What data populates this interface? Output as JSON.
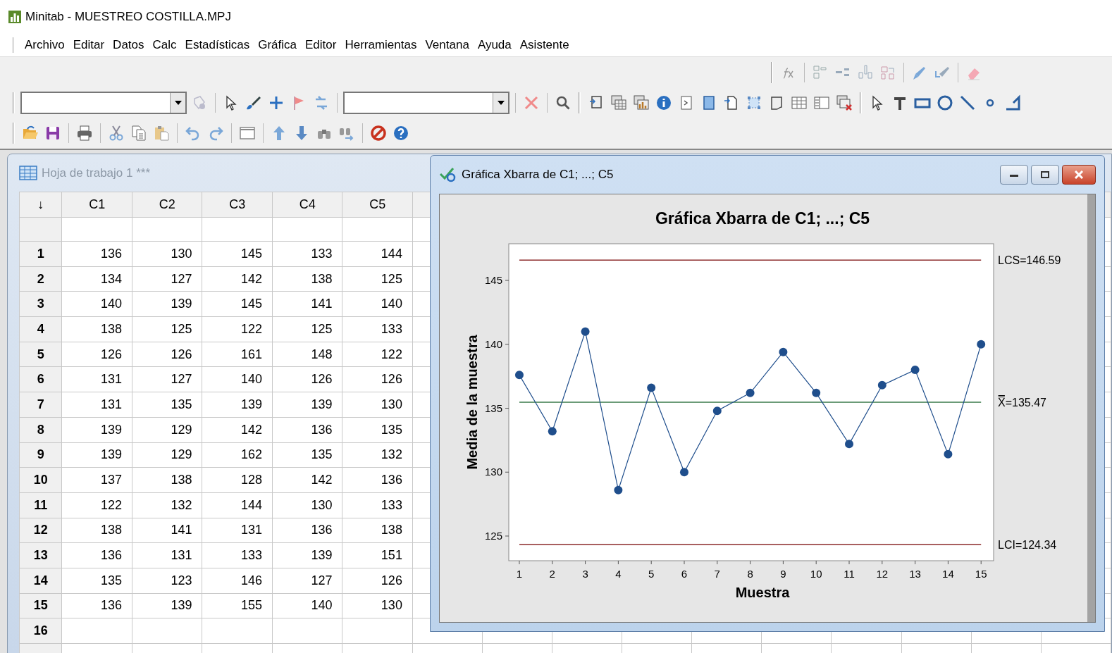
{
  "window": {
    "title": "Minitab - MUESTREO COSTILLA.MPJ"
  },
  "menu": [
    "Archivo",
    "Editar",
    "Datos",
    "Calc",
    "Estadísticas",
    "Gráfica",
    "Editor",
    "Herramientas",
    "Ventana",
    "Ayuda",
    "Asistente"
  ],
  "worksheet": {
    "title": "Hoja de trabajo 1 ***",
    "corner": "↓",
    "columns": [
      "C1",
      "C2",
      "C3",
      "C4",
      "C5"
    ],
    "rows": [
      {
        "number": "1",
        "cells": [
          "136",
          "130",
          "145",
          "133",
          "144"
        ]
      },
      {
        "number": "2",
        "cells": [
          "134",
          "127",
          "142",
          "138",
          "125"
        ]
      },
      {
        "number": "3",
        "cells": [
          "140",
          "139",
          "145",
          "141",
          "140"
        ]
      },
      {
        "number": "4",
        "cells": [
          "138",
          "125",
          "122",
          "125",
          "133"
        ]
      },
      {
        "number": "5",
        "cells": [
          "126",
          "126",
          "161",
          "148",
          "122"
        ]
      },
      {
        "number": "6",
        "cells": [
          "131",
          "127",
          "140",
          "126",
          "126"
        ]
      },
      {
        "number": "7",
        "cells": [
          "131",
          "135",
          "139",
          "139",
          "130"
        ]
      },
      {
        "number": "8",
        "cells": [
          "139",
          "129",
          "142",
          "136",
          "135"
        ]
      },
      {
        "number": "9",
        "cells": [
          "139",
          "129",
          "162",
          "135",
          "132"
        ]
      },
      {
        "number": "10",
        "cells": [
          "137",
          "138",
          "128",
          "142",
          "136"
        ]
      },
      {
        "number": "11",
        "cells": [
          "122",
          "132",
          "144",
          "130",
          "133"
        ]
      },
      {
        "number": "12",
        "cells": [
          "138",
          "141",
          "131",
          "136",
          "138"
        ]
      },
      {
        "number": "13",
        "cells": [
          "136",
          "131",
          "133",
          "139",
          "151"
        ]
      },
      {
        "number": "14",
        "cells": [
          "135",
          "123",
          "146",
          "127",
          "126"
        ]
      },
      {
        "number": "15",
        "cells": [
          "136",
          "139",
          "155",
          "140",
          "130"
        ]
      },
      {
        "number": "16"
      }
    ]
  },
  "graph_window": {
    "title": "Gráfica Xbarra de C1; ...; C5",
    "chart_data": {
      "type": "line",
      "title": "Gráfica Xbarra de C1; ...; C5",
      "xlabel": "Muestra",
      "ylabel": "Media de la muestra",
      "x": [
        1,
        2,
        3,
        4,
        5,
        6,
        7,
        8,
        9,
        10,
        11,
        12,
        13,
        14,
        15
      ],
      "series": [
        {
          "color": "#1f4e8c",
          "marker": "circle",
          "values": [
            137.6,
            133.2,
            141.0,
            128.6,
            136.6,
            130.0,
            134.8,
            136.2,
            139.4,
            136.2,
            132.2,
            136.8,
            138.0,
            131.4,
            140.0
          ]
        }
      ],
      "xlim": [
        0.68,
        15.38
      ],
      "ylim": [
        123.07,
        147.87
      ],
      "xticks": [
        1,
        2,
        3,
        4,
        5,
        6,
        7,
        8,
        9,
        10,
        11,
        12,
        13,
        14,
        15
      ],
      "yticks": [
        125,
        130,
        135,
        140,
        145
      ],
      "ref_lines": [
        {
          "axis": "y",
          "value": 146.59,
          "label": "LCS=146.59",
          "color": "#8b2a2a"
        },
        {
          "axis": "y",
          "value": 135.47,
          "label": "X̿=135.47",
          "color": "#3a7a4a"
        },
        {
          "axis": "y",
          "value": 124.34,
          "label": "LCI=124.34",
          "color": "#8b2a2a"
        }
      ]
    }
  }
}
